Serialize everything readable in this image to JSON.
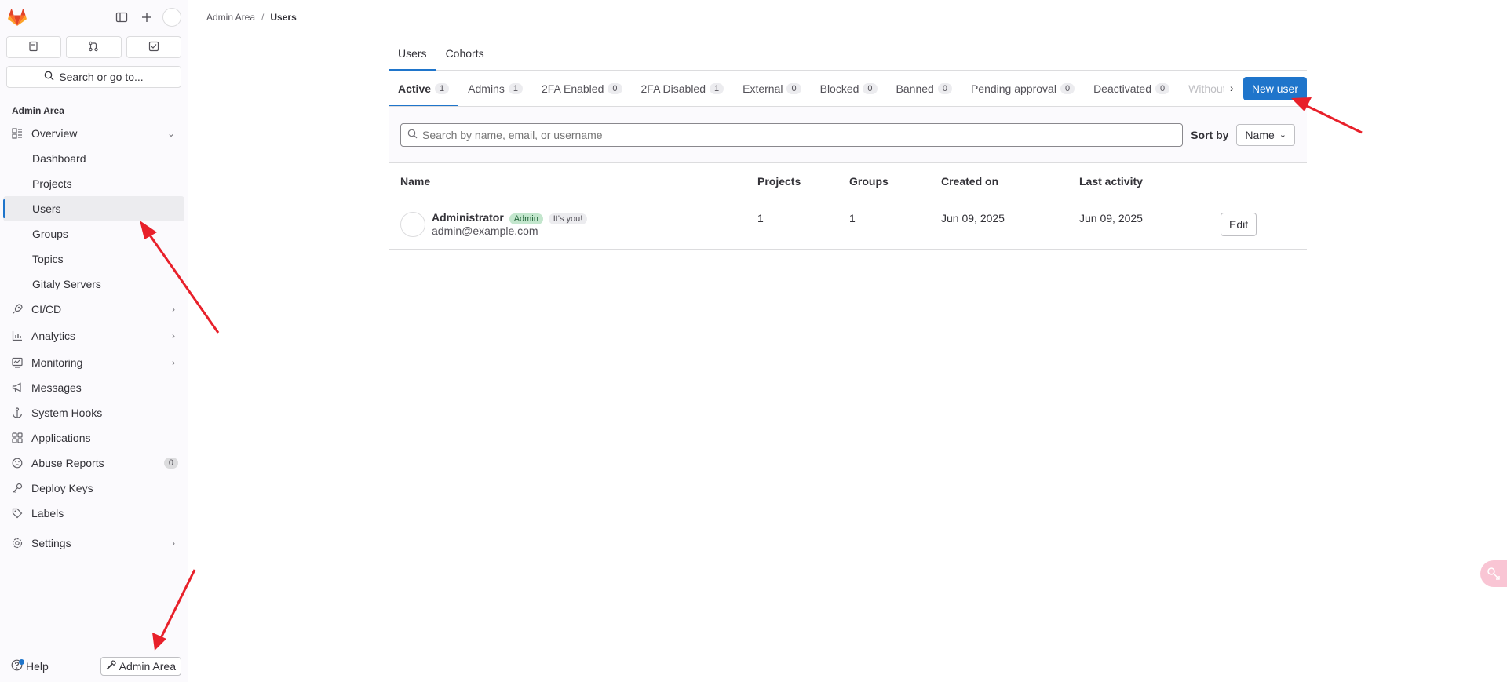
{
  "sidebar": {
    "section_title": "Admin Area",
    "search_label": "Search or go to...",
    "items": [
      {
        "label": "Overview",
        "icon": "overview-icon"
      },
      {
        "label": "Dashboard"
      },
      {
        "label": "Projects"
      },
      {
        "label": "Users"
      },
      {
        "label": "Groups"
      },
      {
        "label": "Topics"
      },
      {
        "label": "Gitaly Servers"
      },
      {
        "label": "CI/CD",
        "icon": "rocket-icon"
      },
      {
        "label": "Analytics",
        "icon": "chart-icon"
      },
      {
        "label": "Monitoring",
        "icon": "monitor-icon"
      },
      {
        "label": "Messages",
        "icon": "megaphone-icon"
      },
      {
        "label": "System Hooks",
        "icon": "anchor-icon"
      },
      {
        "label": "Applications",
        "icon": "apps-icon"
      },
      {
        "label": "Abuse Reports",
        "icon": "abuse-icon",
        "count": "0"
      },
      {
        "label": "Deploy Keys",
        "icon": "key-icon"
      },
      {
        "label": "Labels",
        "icon": "label-icon"
      },
      {
        "label": "Settings",
        "icon": "settings-icon"
      }
    ],
    "help_label": "Help",
    "admin_area_button": "Admin Area"
  },
  "breadcrumb": {
    "parent": "Admin Area",
    "separator": "/",
    "current": "Users"
  },
  "top_tabs": [
    "Users",
    "Cohorts"
  ],
  "filter_tabs": [
    {
      "label": "Active",
      "count": "1"
    },
    {
      "label": "Admins",
      "count": "1"
    },
    {
      "label": "2FA Enabled",
      "count": "0"
    },
    {
      "label": "2FA Disabled",
      "count": "1"
    },
    {
      "label": "External",
      "count": "0"
    },
    {
      "label": "Blocked",
      "count": "0"
    },
    {
      "label": "Banned",
      "count": "0"
    },
    {
      "label": "Pending approval",
      "count": "0"
    },
    {
      "label": "Deactivated",
      "count": "0"
    },
    {
      "label": "Without"
    }
  ],
  "new_user_button": "New user",
  "search": {
    "placeholder": "Search by name, email, or username"
  },
  "sort": {
    "label": "Sort by",
    "value": "Name"
  },
  "table": {
    "headers": [
      "Name",
      "Projects",
      "Groups",
      "Created on",
      "Last activity"
    ],
    "rows": [
      {
        "name": "Administrator",
        "badge_admin": "Admin",
        "badge_you": "It's you!",
        "email": "admin@example.com",
        "projects": "1",
        "groups": "1",
        "created_on": "Jun 09, 2025",
        "last_activity": "Jun 09, 2025",
        "action": "Edit"
      }
    ]
  },
  "colors": {
    "accent": "#1f75cb",
    "annotation_arrow": "#e8202a"
  }
}
